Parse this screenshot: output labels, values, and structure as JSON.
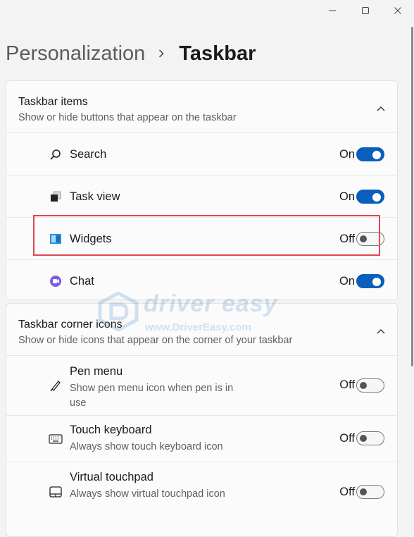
{
  "breadcrumb": {
    "parent": "Personalization",
    "current": "Taskbar"
  },
  "taskbar_items": {
    "title": "Taskbar items",
    "subtitle": "Show or hide buttons that appear on the taskbar",
    "items": [
      {
        "label": "Search",
        "state": "On",
        "enabled": true,
        "icon": "search-icon"
      },
      {
        "label": "Task view",
        "state": "On",
        "enabled": true,
        "icon": "task-view-icon"
      },
      {
        "label": "Widgets",
        "state": "Off",
        "enabled": false,
        "icon": "widgets-icon",
        "highlighted": true
      },
      {
        "label": "Chat",
        "state": "On",
        "enabled": true,
        "icon": "chat-icon"
      }
    ]
  },
  "corner_icons": {
    "title": "Taskbar corner icons",
    "subtitle": "Show or hide icons that appear on the corner of your taskbar",
    "items": [
      {
        "label": "Pen menu",
        "desc": "Show pen menu icon when pen is in use",
        "state": "Off",
        "enabled": false,
        "icon": "pen-icon"
      },
      {
        "label": "Touch keyboard",
        "desc": "Always show touch keyboard icon",
        "state": "Off",
        "enabled": false,
        "icon": "keyboard-icon"
      },
      {
        "label": "Virtual touchpad",
        "desc": "Always show virtual touchpad icon",
        "state": "Off",
        "enabled": false,
        "icon": "touchpad-icon"
      }
    ]
  },
  "watermark": {
    "brand": "driver easy",
    "url": "www.DriverEasy.com"
  },
  "colors": {
    "accent": "#0a5fbd",
    "highlight": "#e0474f",
    "background": "#f3f3f3",
    "card": "#fbfbfb"
  }
}
